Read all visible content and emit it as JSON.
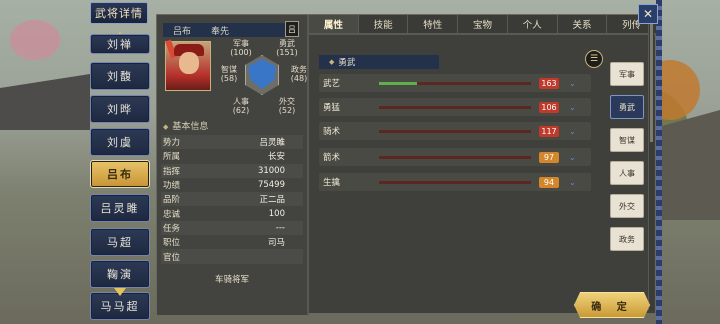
{
  "window_title": "武将详情",
  "close_icon": "✕",
  "confirm_label": "确 定",
  "character_list": [
    {
      "name": "刘禅",
      "selected": false
    },
    {
      "name": "刘馥",
      "selected": false
    },
    {
      "name": "刘晔",
      "selected": false
    },
    {
      "name": "刘虞",
      "selected": false
    },
    {
      "name": "吕布",
      "selected": true
    },
    {
      "name": "吕灵雎",
      "selected": false
    },
    {
      "name": "马超",
      "selected": false
    },
    {
      "name": "鞠演",
      "selected": false
    },
    {
      "name": "马马超",
      "selected": false
    }
  ],
  "profile": {
    "name": "吕布",
    "courtesy": "奉先",
    "tag": "吕",
    "stats": {
      "military": {
        "label": "军事",
        "value": "(100)"
      },
      "valor": {
        "label": "勇武",
        "value": "(151)"
      },
      "strategy": {
        "label": "智谋",
        "value": "(58)"
      },
      "politics": {
        "label": "政务",
        "value": "(48)"
      },
      "personnel": {
        "label": "人事",
        "value": "(62)"
      },
      "diplomacy": {
        "label": "外交",
        "value": "(52)"
      }
    }
  },
  "basic_info": {
    "title": "基本信息",
    "rows": [
      {
        "k": "势力",
        "v": "吕灵雎"
      },
      {
        "k": "所属",
        "v": "长安"
      },
      {
        "k": "指挥",
        "v": "31000"
      },
      {
        "k": "功绩",
        "v": "75499"
      },
      {
        "k": "品阶",
        "v": "正二品"
      },
      {
        "k": "忠诚",
        "v": "100"
      },
      {
        "k": "任务",
        "v": "---"
      },
      {
        "k": "职位",
        "v": "司马"
      },
      {
        "k": "官位",
        "v": ""
      }
    ],
    "rank_title": "车骑将军"
  },
  "tabs": [
    {
      "label": "属性",
      "active": true
    },
    {
      "label": "技能",
      "active": false
    },
    {
      "label": "特性",
      "active": false
    },
    {
      "label": "宝物",
      "active": false
    },
    {
      "label": "个人",
      "active": false
    },
    {
      "label": "关系",
      "active": false
    },
    {
      "label": "列传",
      "active": false
    }
  ],
  "section": {
    "title": "勇武",
    "menu_icon": "☰",
    "skills": [
      {
        "name": "武艺",
        "value": "163",
        "progress": 0.25,
        "fill_color": "#5fb04a",
        "badge_color": "#c0392b"
      },
      {
        "name": "勇猛",
        "value": "106",
        "progress": 0.0,
        "fill_color": "#5fb04a",
        "badge_color": "#c0392b"
      },
      {
        "name": "骑术",
        "value": "117",
        "progress": 0.0,
        "fill_color": "#5fb04a",
        "badge_color": "#c0392b"
      },
      {
        "name": "箭术",
        "value": "97",
        "progress": 0.0,
        "fill_color": "#5fb04a",
        "badge_color": "#d4872a"
      },
      {
        "name": "生擒",
        "value": "94",
        "progress": 0.0,
        "fill_color": "#5fb04a",
        "badge_color": "#d4872a"
      }
    ]
  },
  "side_buttons": [
    {
      "label": "军事",
      "active": false
    },
    {
      "label": "勇武",
      "active": true
    },
    {
      "label": "智谋",
      "active": false
    },
    {
      "label": "人事",
      "active": false
    },
    {
      "label": "外交",
      "active": false
    },
    {
      "label": "政务",
      "active": false
    }
  ]
}
